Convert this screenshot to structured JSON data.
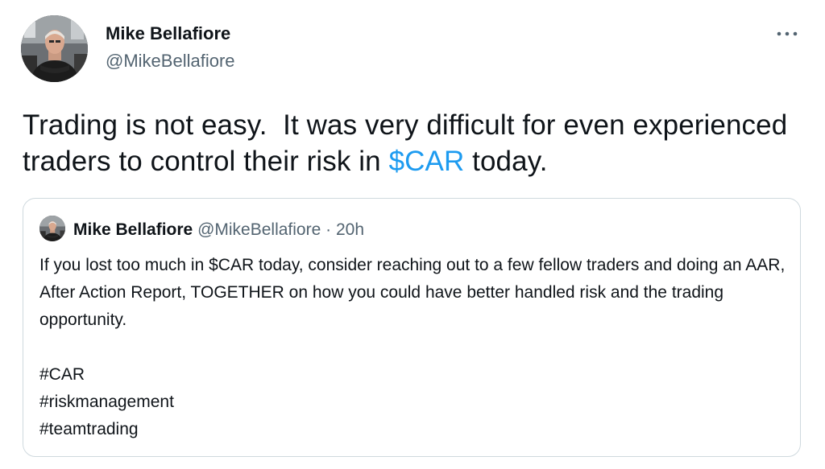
{
  "tweet": {
    "author_name": "Mike Bellafiore",
    "author_handle": "@MikeBellafiore",
    "text_part1": "Trading is not easy.  It was very difficult for even experienced traders to control their risk in ",
    "cashtag": "$CAR",
    "text_part2": " today.",
    "more_icon": "more-horizontal-icon"
  },
  "quoted_tweet": {
    "author_name": "Mike Bellafiore",
    "author_handle": "@MikeBellafiore",
    "separator": "·",
    "time": "20h",
    "body": "If you lost too much in $CAR today, consider reaching out to a few fellow traders and doing an AAR, After Action Report, TOGETHER on how you could have better handled risk and the trading opportunity.",
    "hashtags": [
      "#CAR",
      "#riskmanagement",
      "#teamtrading"
    ]
  },
  "colors": {
    "link": "#1d9bf0",
    "secondary_text": "#536471",
    "border": "#cfd9de"
  }
}
